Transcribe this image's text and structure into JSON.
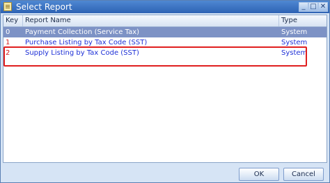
{
  "window": {
    "title": "Select Report",
    "icon": "report-icon"
  },
  "titlebar_buttons": {
    "minimize": "_",
    "maximize": "□",
    "close": "✕"
  },
  "grid": {
    "columns": [
      "Key",
      "Report Name",
      "Type"
    ],
    "rows": [
      {
        "key": "0",
        "name": "Payment Collection (Service Tax)",
        "type": "System",
        "selected": true
      },
      {
        "key": "1",
        "name": "Purchase Listing by Tax Code (SST)",
        "type": "System",
        "selected": false
      },
      {
        "key": "2",
        "name": "Supply Listing by Tax Code (SST)",
        "type": "System",
        "selected": false
      }
    ]
  },
  "buttons": {
    "ok": "OK",
    "cancel": "Cancel"
  },
  "colors": {
    "selected_row": "#7d92c5",
    "highlight_box": "#e01e1e",
    "row_text": "#1d2fd6"
  }
}
